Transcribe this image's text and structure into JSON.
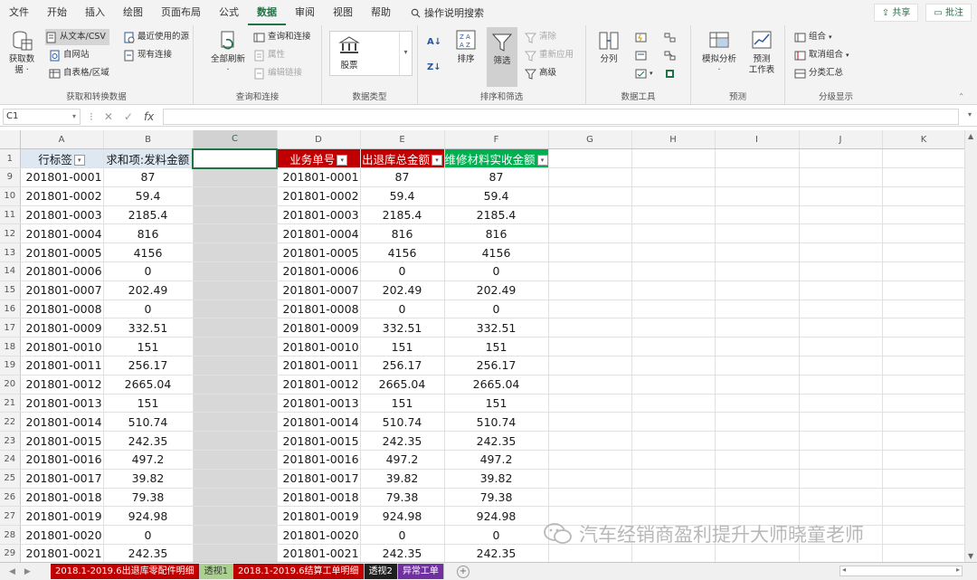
{
  "menu": {
    "tabs": [
      "文件",
      "开始",
      "插入",
      "绘图",
      "页面布局",
      "公式",
      "数据",
      "审阅",
      "视图",
      "帮助"
    ],
    "active_index": 6,
    "search_label": "操作说明搜索",
    "share_label": "共享",
    "comment_label": "批注"
  },
  "ribbon": {
    "get_data": {
      "name": "获取和转换数据",
      "big_label": "获取数\n据 ·",
      "items": [
        "从文本/CSV",
        "自网站",
        "自表格/区域",
        "最近使用的源",
        "现有连接"
      ]
    },
    "queries": {
      "name": "查询和连接",
      "big_label": "全部刷新\n·",
      "items": [
        "查询和连接",
        "属性",
        "编辑链接"
      ]
    },
    "data_types": {
      "name": "数据类型",
      "stocks_label": "股票"
    },
    "sort_filter": {
      "name": "排序和筛选",
      "sort_label": "排序",
      "filter_label": "筛选",
      "items": [
        "清除",
        "重新应用",
        "高级"
      ]
    },
    "data_tools": {
      "name": "数据工具",
      "split_label": "分列"
    },
    "forecast": {
      "name": "预测",
      "whatif_label": "模拟分析\n·",
      "sheet_label": "预测\n工作表"
    },
    "outline": {
      "name": "分级显示",
      "items": [
        "组合",
        "取消组合",
        "分类汇总"
      ]
    }
  },
  "formula_bar": {
    "name_box": "C1",
    "fx_label": "fx",
    "content": ""
  },
  "columns": [
    "A",
    "B",
    "C",
    "D",
    "E",
    "F",
    "G",
    "H",
    "I",
    "J",
    "K"
  ],
  "selected_column": "C",
  "headers": {
    "A": "行标签",
    "B": "求和项:发料金额",
    "D": "业务单号",
    "E": "出退库总金额",
    "F": "维修材料实收金额"
  },
  "rows": [
    {
      "row": "1",
      "header": true
    },
    {
      "row": "9",
      "id": "201801-0001",
      "b": "87",
      "d": "201801-0001",
      "e": "87",
      "f": "87"
    },
    {
      "row": "10",
      "id": "201801-0002",
      "b": "59.4",
      "d": "201801-0002",
      "e": "59.4",
      "f": "59.4"
    },
    {
      "row": "11",
      "id": "201801-0003",
      "b": "2185.4",
      "d": "201801-0003",
      "e": "2185.4",
      "f": "2185.4"
    },
    {
      "row": "12",
      "id": "201801-0004",
      "b": "816",
      "d": "201801-0004",
      "e": "816",
      "f": "816"
    },
    {
      "row": "13",
      "id": "201801-0005",
      "b": "4156",
      "d": "201801-0005",
      "e": "4156",
      "f": "4156"
    },
    {
      "row": "14",
      "id": "201801-0006",
      "b": "0",
      "d": "201801-0006",
      "e": "0",
      "f": "0"
    },
    {
      "row": "15",
      "id": "201801-0007",
      "b": "202.49",
      "d": "201801-0007",
      "e": "202.49",
      "f": "202.49"
    },
    {
      "row": "16",
      "id": "201801-0008",
      "b": "0",
      "d": "201801-0008",
      "e": "0",
      "f": "0"
    },
    {
      "row": "17",
      "id": "201801-0009",
      "b": "332.51",
      "d": "201801-0009",
      "e": "332.51",
      "f": "332.51"
    },
    {
      "row": "18",
      "id": "201801-0010",
      "b": "151",
      "d": "201801-0010",
      "e": "151",
      "f": "151"
    },
    {
      "row": "19",
      "id": "201801-0011",
      "b": "256.17",
      "d": "201801-0011",
      "e": "256.17",
      "f": "256.17"
    },
    {
      "row": "20",
      "id": "201801-0012",
      "b": "2665.04",
      "d": "201801-0012",
      "e": "2665.04",
      "f": "2665.04"
    },
    {
      "row": "21",
      "id": "201801-0013",
      "b": "151",
      "d": "201801-0013",
      "e": "151",
      "f": "151"
    },
    {
      "row": "22",
      "id": "201801-0014",
      "b": "510.74",
      "d": "201801-0014",
      "e": "510.74",
      "f": "510.74"
    },
    {
      "row": "23",
      "id": "201801-0015",
      "b": "242.35",
      "d": "201801-0015",
      "e": "242.35",
      "f": "242.35"
    },
    {
      "row": "24",
      "id": "201801-0016",
      "b": "497.2",
      "d": "201801-0016",
      "e": "497.2",
      "f": "497.2"
    },
    {
      "row": "25",
      "id": "201801-0017",
      "b": "39.82",
      "d": "201801-0017",
      "e": "39.82",
      "f": "39.82"
    },
    {
      "row": "26",
      "id": "201801-0018",
      "b": "79.38",
      "d": "201801-0018",
      "e": "79.38",
      "f": "79.38"
    },
    {
      "row": "27",
      "id": "201801-0019",
      "b": "924.98",
      "d": "201801-0019",
      "e": "924.98",
      "f": "924.98"
    },
    {
      "row": "28",
      "id": "201801-0020",
      "b": "0",
      "d": "201801-0020",
      "e": "0",
      "f": "0"
    },
    {
      "row": "29",
      "id": "201801-0021",
      "b": "242.35",
      "d": "201801-0021",
      "e": "242.35",
      "f": "242.35"
    }
  ],
  "sheet_tabs": [
    {
      "label": "2018.1-2019.6出退库零配件明细",
      "bg": "#c00000",
      "fg": "#ffffff"
    },
    {
      "label": "透视1",
      "bg": "#a9d08e",
      "fg": "#333333"
    },
    {
      "label": "2018.1-2019.6结算工单明细",
      "bg": "#c00000",
      "fg": "#ffffff"
    },
    {
      "label": "透视2",
      "bg": "#1f1f1f",
      "fg": "#ffffff"
    },
    {
      "label": "异常工单",
      "bg": "#7030a0",
      "fg": "#ffffff"
    }
  ],
  "watermark": "汽车经销商盈利提升大师晓童老师",
  "colors": {
    "accent": "#217346",
    "red_header": "#c00000",
    "green_header": "#00b050",
    "pivot_header": "#dde8f2"
  }
}
